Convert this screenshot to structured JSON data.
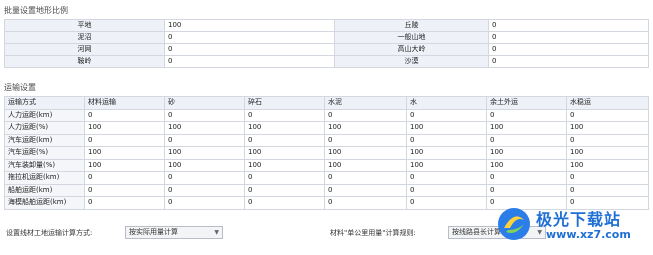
{
  "terrain_section": {
    "title": "批量设置地形比例",
    "rows": [
      {
        "l1": "平地",
        "v1": "100",
        "l2": "丘陵",
        "v2": "0"
      },
      {
        "l1": "泥沼",
        "v1": "0",
        "l2": "一般山地",
        "v2": "0"
      },
      {
        "l1": "河网",
        "v1": "0",
        "l2": "高山大岭",
        "v2": "0"
      },
      {
        "l1": "鞍岭",
        "v1": "0",
        "l2": "沙漠",
        "v2": "0"
      }
    ]
  },
  "transport_section": {
    "title": "运输设置",
    "headers": [
      "运输方式",
      "材料运输",
      "砂",
      "碎石",
      "水泥",
      "水",
      "余土外运",
      "水稳运"
    ],
    "rows": [
      {
        "label": "人力运距(km)",
        "values": [
          "0",
          "0",
          "0",
          "0",
          "0",
          "0",
          "0"
        ]
      },
      {
        "label": "人力运距(%)",
        "values": [
          "100",
          "100",
          "100",
          "100",
          "100",
          "100",
          "100"
        ]
      },
      {
        "label": "汽车运距(km)",
        "values": [
          "0",
          "0",
          "0",
          "0",
          "0",
          "0",
          "0"
        ]
      },
      {
        "label": "汽车运距(%)",
        "values": [
          "100",
          "100",
          "100",
          "100",
          "100",
          "100",
          "100"
        ]
      },
      {
        "label": "汽车装卸量(%)",
        "values": [
          "100",
          "100",
          "100",
          "100",
          "100",
          "100",
          "100"
        ]
      },
      {
        "label": "拖拉机运距(km)",
        "values": [
          "0",
          "0",
          "0",
          "0",
          "0",
          "0",
          "0"
        ]
      },
      {
        "label": "船舶运距(km)",
        "values": [
          "0",
          "0",
          "0",
          "0",
          "0",
          "0",
          "0"
        ]
      },
      {
        "label": "海模船舶运距(km)",
        "values": [
          "0",
          "0",
          "0",
          "0",
          "0",
          "0",
          "0"
        ]
      }
    ]
  },
  "bottom": {
    "method_label": "设置线材工地运输计算方式:",
    "method_value": "按实际用量计算",
    "rule_label": "材料\"单公里用量\"计算规则:",
    "rule_value": "按线路县长计算"
  },
  "watermark": {
    "text": "极光下载站",
    "url": "www.xz7.com"
  }
}
